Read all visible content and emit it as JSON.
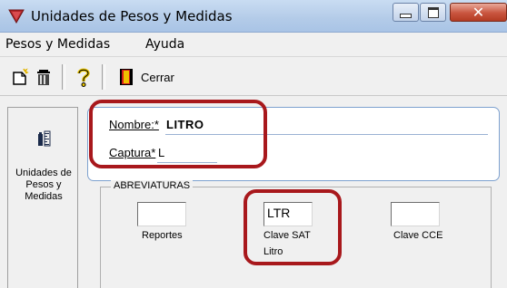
{
  "window": {
    "title": "Unidades de Pesos y Medidas",
    "minimize_glyph": "",
    "close_glyph": "✕"
  },
  "menu": {
    "items": [
      "Pesos y Medidas",
      "Ayuda"
    ]
  },
  "toolbar": {
    "close_label": "Cerrar"
  },
  "left_panel": {
    "label": "Unidades de Pesos y Medidas"
  },
  "form": {
    "nombre_label": "Nombre:*",
    "nombre_value": "LITRO",
    "captura_label": "Captura*",
    "captura_value": "L"
  },
  "abreviaturas": {
    "legend": "ABREVIATURAS",
    "reportes_value": "",
    "reportes_label": "Reportes",
    "clave_sat_value": "LTR",
    "clave_sat_label": "Clave SAT",
    "clave_sat_description": "Litro",
    "clave_cce_value": "",
    "clave_cce_label": "Clave CCE"
  },
  "colors": {
    "highlight": "#a8181c",
    "title_bar": "#b3cbe8",
    "close_button": "#c9553f"
  },
  "icons": [
    "app-window-icon",
    "new-document-icon",
    "trash-icon",
    "help-icon",
    "exit-door-icon",
    "scale-units-icon"
  ]
}
